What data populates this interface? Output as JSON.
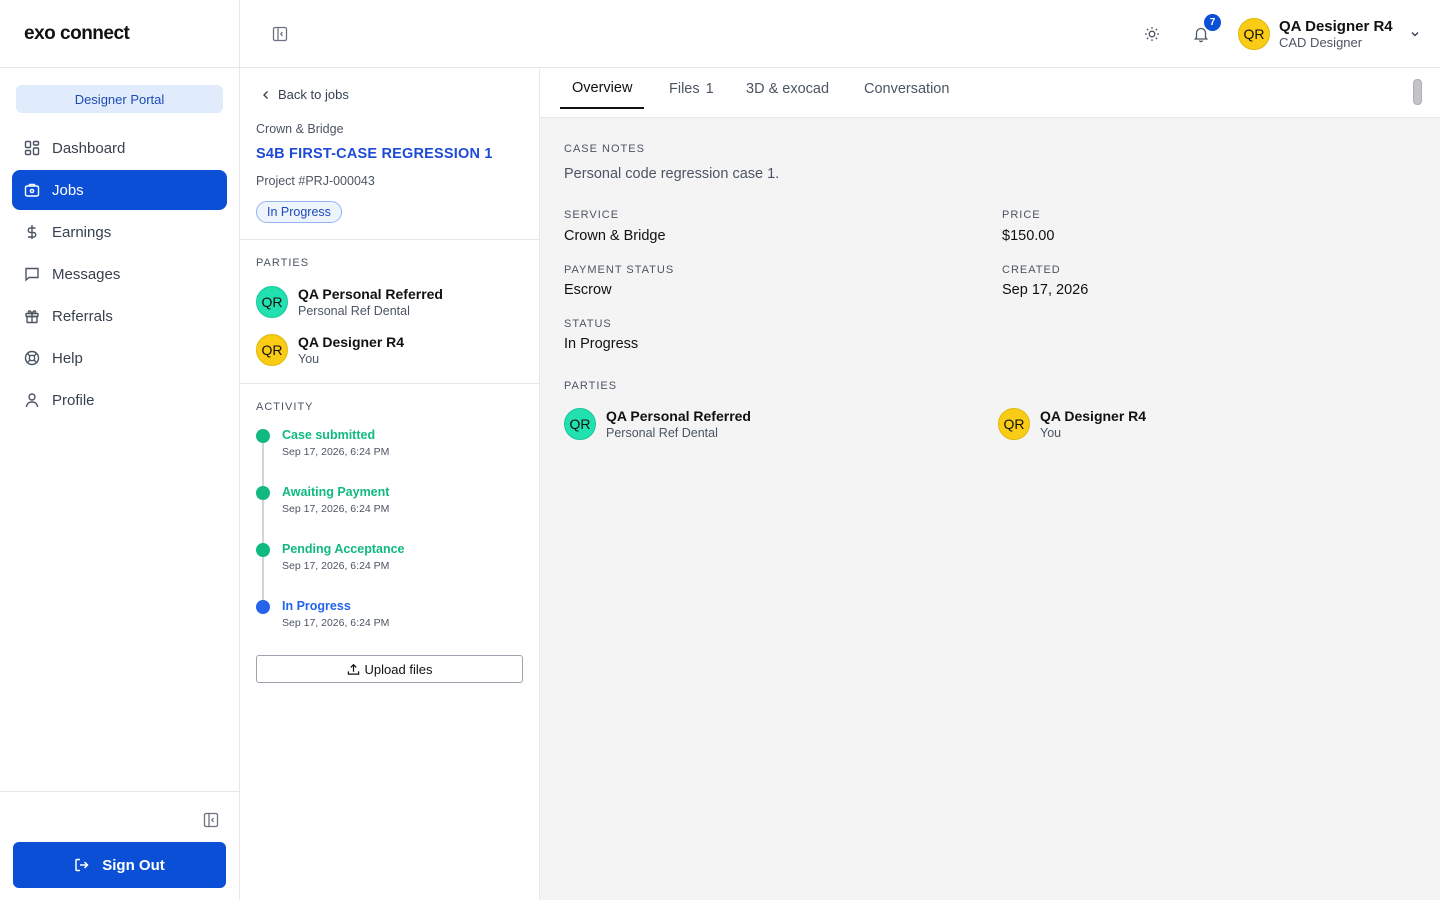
{
  "app": {
    "logo": "exo connect",
    "portal_label": "Designer Portal"
  },
  "sidebar": {
    "items": [
      {
        "label": "Dashboard",
        "icon": "dashboard-icon",
        "active": false
      },
      {
        "label": "Jobs",
        "icon": "briefcase-icon",
        "active": true
      },
      {
        "label": "Earnings",
        "icon": "dollar-icon",
        "active": false
      },
      {
        "label": "Messages",
        "icon": "message-icon",
        "active": false
      },
      {
        "label": "Referrals",
        "icon": "gift-icon",
        "active": false
      },
      {
        "label": "Help",
        "icon": "lifebuoy-icon",
        "active": false
      },
      {
        "label": "Profile",
        "icon": "user-icon",
        "active": false
      }
    ],
    "sign_out_label": "Sign Out"
  },
  "header": {
    "notification_count": "7",
    "user": {
      "initials": "QR",
      "name": "QA Designer R4",
      "role": "CAD Designer"
    }
  },
  "job": {
    "back_label": "Back to jobs",
    "category": "Crown & Bridge",
    "title": "S4B FIRST-CASE REGRESSION 1",
    "project": "Project #PRJ-000043",
    "status": "In Progress",
    "parties_label": "PARTIES",
    "parties": [
      {
        "initials": "QR",
        "name": "QA Personal Referred",
        "sub": "Personal Ref Dental",
        "color": "#22e0b0"
      },
      {
        "initials": "QR",
        "name": "QA Designer R4",
        "sub": "You",
        "color": "#facc15"
      }
    ],
    "activity_label": "ACTIVITY",
    "activity": [
      {
        "title": "Case submitted",
        "time": "Sep 17, 2026, 6:24 PM",
        "color": "#10b981"
      },
      {
        "title": "Awaiting Payment",
        "time": "Sep 17, 2026, 6:24 PM",
        "color": "#10b981"
      },
      {
        "title": "Pending Acceptance",
        "time": "Sep 17, 2026, 6:24 PM",
        "color": "#10b981"
      },
      {
        "title": "In Progress",
        "time": "Sep 17, 2026, 6:24 PM",
        "color": "#2563eb"
      }
    ],
    "upload_label": "Upload files"
  },
  "tabs": [
    {
      "label": "Overview",
      "count": "",
      "active": true
    },
    {
      "label": "Files",
      "count": "1",
      "active": false
    },
    {
      "label": "3D & exocad",
      "count": "",
      "active": false
    },
    {
      "label": "Conversation",
      "count": "",
      "active": false
    }
  ],
  "overview": {
    "case_notes_label": "CASE NOTES",
    "case_notes": "Personal code regression case 1.",
    "service_label": "SERVICE",
    "service": "Crown & Bridge",
    "price_label": "PRICE",
    "price": "$150.00",
    "payment_status_label": "PAYMENT STATUS",
    "payment_status": "Escrow",
    "created_label": "CREATED",
    "created": "Sep 17, 2026",
    "status_label": "STATUS",
    "status": "In Progress",
    "parties_label": "PARTIES"
  },
  "colors": {
    "primary": "#0b4fd6",
    "success": "#10b981",
    "info": "#2563eb",
    "badge_bg": "#e0ecfb"
  }
}
